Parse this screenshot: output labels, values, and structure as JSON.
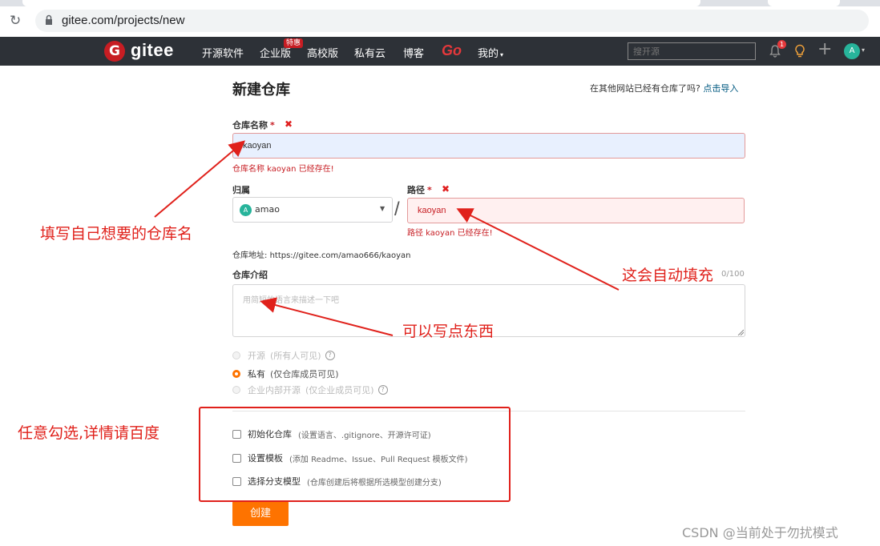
{
  "browser": {
    "url": "gitee.com/projects/new",
    "reload_icon": "reload-icon",
    "lock_icon": "lock-icon"
  },
  "nav": {
    "logo_glyph": "G",
    "logo_text": "gitee",
    "items": [
      "开源软件",
      "企业版",
      "高校版",
      "私有云",
      "博客"
    ],
    "go_label": "Go",
    "mine_label": "我的",
    "special_badge": "特惠",
    "search_placeholder": "搜开源",
    "notification_count": "1",
    "avatar_letter": "A",
    "plus": "+"
  },
  "form": {
    "title": "新建仓库",
    "import_prompt": "在其他网站已经有仓库了吗?",
    "import_link": "点击导入",
    "name_label": "仓库名称",
    "required_mark": "*",
    "error_mark": "✖",
    "name_value": "kaoyan",
    "name_error": "仓库名称 kaoyan 已经存在!",
    "owner_label": "归属",
    "owner_avatar_letter": "A",
    "owner_value": "amao",
    "slash": "/",
    "path_label": "路径",
    "path_value": "kaoyan",
    "path_error": "路径 kaoyan 已经存在!",
    "repo_url_label": "仓库地址:",
    "repo_url": "https://gitee.com/amao666/kaoyan",
    "intro_label": "仓库介绍",
    "intro_counter": "0/100",
    "intro_placeholder": "用简短的语言来描述一下吧",
    "visibility": [
      {
        "label": "开源",
        "desc": "(所有人可见)",
        "selected": false,
        "help": true
      },
      {
        "label": "私有",
        "desc": "(仅仓库成员可见)",
        "selected": true,
        "help": false
      },
      {
        "label": "企业内部开源",
        "desc": "(仅企业成员可见)",
        "selected": false,
        "help": true
      }
    ],
    "help_glyph": "?",
    "options": [
      {
        "label": "初始化仓库",
        "desc": "(设置语言、.gitignore、开源许可证)",
        "checked": false
      },
      {
        "label": "设置模板",
        "desc": "(添加 Readme、Issue、Pull Request 模板文件)",
        "checked": false
      },
      {
        "label": "选择分支模型",
        "desc": "(仓库创建后将根据所选模型创建分支)",
        "checked": false
      }
    ],
    "create_button": "创建"
  },
  "annotations": {
    "name_hint": "填写自己想要的仓库名",
    "path_hint": "这会自动填充",
    "intro_hint": "可以写点东西",
    "options_hint": "任意勾选,详情请百度"
  },
  "watermark": "CSDN @当前处于勿扰模式",
  "colors": {
    "nav_bg": "#2d3137",
    "brand_red": "#c71d23",
    "accent_orange": "#fe7300",
    "error_red": "#c71d23",
    "annotation_red": "#e0211b"
  }
}
